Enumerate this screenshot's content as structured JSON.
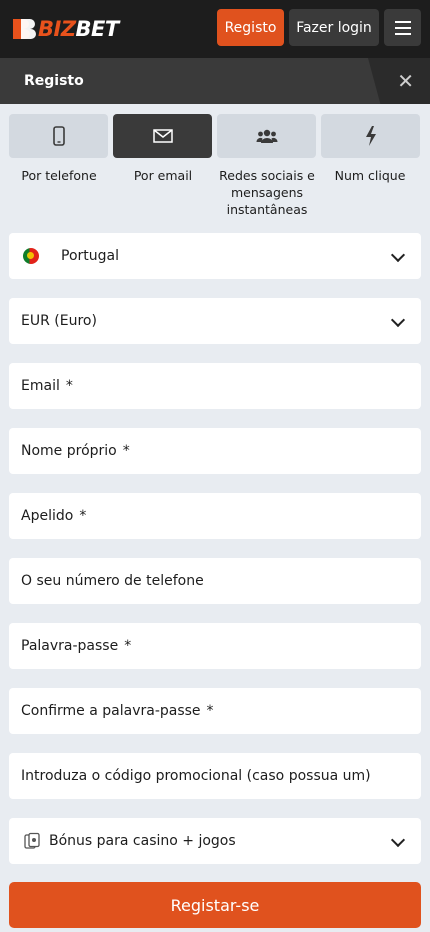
{
  "header": {
    "logo": {
      "part1": "BIZ",
      "part2": "BET"
    },
    "register_label": "Registo",
    "login_label": "Fazer login",
    "menu_icon": "hamburger-icon"
  },
  "section": {
    "title": "Registo",
    "close_icon": "close-icon"
  },
  "tabs": [
    {
      "label": "Por telefone",
      "icon": "phone-icon",
      "active": false
    },
    {
      "label": "Por email",
      "icon": "envelope-icon",
      "active": true
    },
    {
      "label": "Redes sociais e mensagens instantâneas",
      "icon": "users-icon",
      "active": false
    },
    {
      "label": "Num clique",
      "icon": "lightning-icon",
      "active": false
    }
  ],
  "form": {
    "country": "Portugal",
    "currency": "EUR (Euro)",
    "email": "Email",
    "first_name": "Nome próprio",
    "last_name": "Apelido",
    "phone": "O seu número de telefone",
    "password": "Palavra-passe",
    "confirm_password": "Confirme a palavra-passe",
    "promo": "Introduza o código promocional (caso possua um)",
    "bonus": "Bónus para casino + jogos",
    "required_mark": "*"
  },
  "submit_label": "Registar-se",
  "colors": {
    "accent": "#e0521e",
    "header_bg": "#1d1d1d",
    "section_bg": "#3a3a3a",
    "page_bg": "#e8ecf1"
  }
}
